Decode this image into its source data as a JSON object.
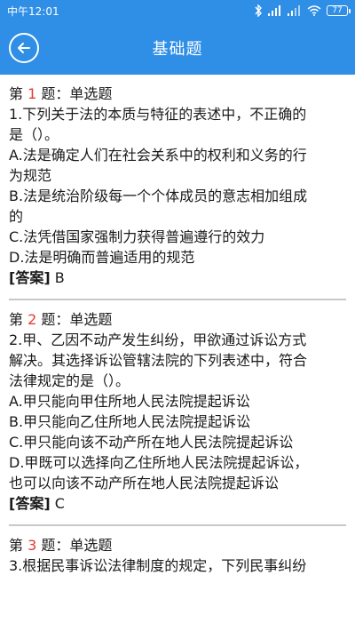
{
  "status": {
    "time": "中午12:01",
    "battery": "77"
  },
  "app": {
    "title": "基础题"
  },
  "questions": [
    {
      "prefix": "第 ",
      "num": "1",
      "suffix": " 题：单选题",
      "stem_line1": "1.下列关于法的本质与特征的表述中，不正确的",
      "stem_line2": "是（）。",
      "options": [
        "A.法是确定人们在社会关系中的权利和义务的行",
        "为规范",
        "B.法是统治阶级每一个个体成员的意志相加组成",
        "的",
        "C.法凭借国家强制力获得普遍遵行的效力",
        "D.法是明确而普遍适用的规范"
      ],
      "answer_label": "[答案]",
      "answer": " B"
    },
    {
      "prefix": "第 ",
      "num": "2",
      "suffix": " 题：单选题",
      "stem_line1": "2.甲、乙因不动产发生纠纷，甲欲通过诉讼方式",
      "stem_line2": "解决。其选择诉讼管辖法院的下列表述中，符合",
      "stem_line3": "法律规定的是（）。",
      "options": [
        "A.甲只能向甲住所地人民法院提起诉讼",
        "B.甲只能向乙住所地人民法院提起诉讼",
        "C.甲只能向该不动产所在地人民法院提起诉讼",
        "D.甲既可以选择向乙住所地人民法院提起诉讼，",
        "也可以向该不动产所在地人民法院提起诉讼"
      ],
      "answer_label": "[答案]",
      "answer": " C"
    },
    {
      "prefix": "第 ",
      "num": "3",
      "suffix": " 题：单选题",
      "stem_line1": "3.根据民事诉讼法律制度的规定，下列民事纠纷"
    }
  ]
}
